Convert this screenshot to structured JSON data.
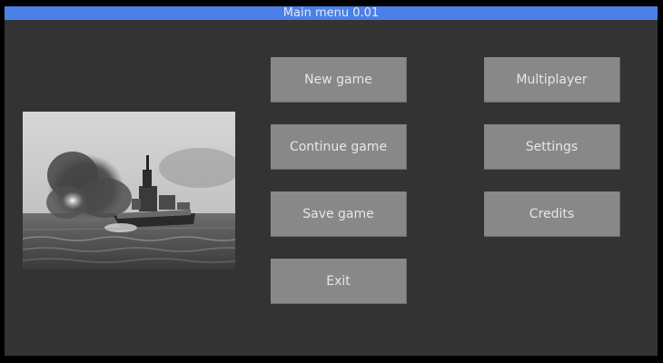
{
  "window": {
    "title": "Main menu 0.01"
  },
  "picture": {
    "icon": "battleship-firing-photo"
  },
  "menu": {
    "new_game": "New game",
    "continue_game": "Continue game",
    "save_game": "Save game",
    "exit": "Exit",
    "multiplayer": "Multiplayer",
    "settings": "Settings",
    "credits": "Credits"
  },
  "colors": {
    "titlebar": "#4a80e8",
    "window_bg": "#333333",
    "button_bg": "#888888",
    "button_text": "#e6e6e6"
  }
}
